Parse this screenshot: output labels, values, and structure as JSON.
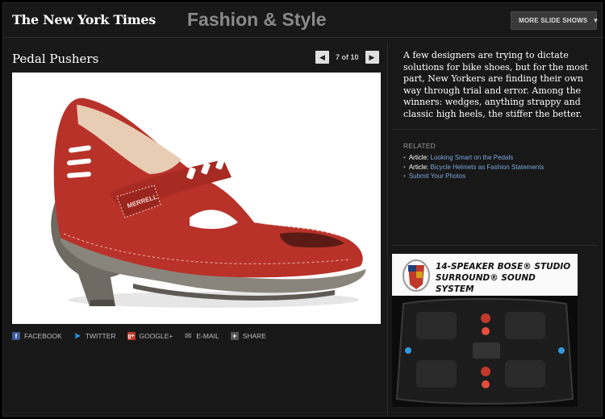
{
  "header": {
    "logo": "The New York Times",
    "section": "Fashion & Style",
    "more_button": "MORE SLIDE SHOWS"
  },
  "slide": {
    "title": "Pedal Pushers",
    "counter": "7 of 10",
    "image_brand_text": "MERRELL",
    "caption": "A few designers are trying to dictate solutions for bike shoes, but for the most part, New Yorkers are finding their own way through trial and error. Among the winners: wedges, anything strappy and classic high heels, the stiffer the better."
  },
  "share": [
    {
      "label": "FACEBOOK",
      "icon": "facebook-icon",
      "color": "#3b5998"
    },
    {
      "label": "TWITTER",
      "icon": "twitter-icon",
      "color": "#1da1f2"
    },
    {
      "label": "GOOGLE+",
      "icon": "google-plus-icon",
      "color": "#c0392b"
    },
    {
      "label": "E-MAIL",
      "icon": "email-icon",
      "color": "#666666"
    },
    {
      "label": "SHARE",
      "icon": "share-icon",
      "color": "#666666"
    }
  ],
  "related": {
    "title": "RELATED",
    "items": [
      {
        "kind": "Article:",
        "link": "Looking Smart on the Pedals"
      },
      {
        "kind": "Article:",
        "link": "Bicycle Helmets as Fashion Statements"
      },
      {
        "kind": "",
        "link": "Submit Your Photos"
      }
    ]
  },
  "ad": {
    "headline_line1": "14-SPEAKER BOSE® STUDIO",
    "headline_line2": "SURROUND® SOUND SYSTEM"
  },
  "colors": {
    "background": "#181818",
    "link": "#79a7d9",
    "shoe": "#b8322a"
  }
}
